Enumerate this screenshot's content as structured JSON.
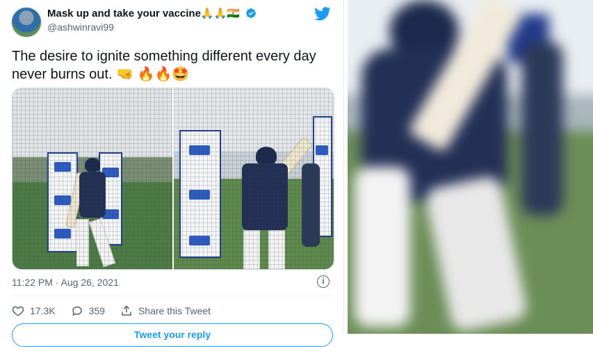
{
  "tweet": {
    "display_name": "Mask up and take your vaccine",
    "name_emojis": "🙏🙏🇮🇳",
    "handle": "@ashwinravi99",
    "text": "The desire to ignite something different every day never burns out. 🤜 🔥🔥🤩",
    "timestamp": "11:22 PM · Aug 26, 2021",
    "likes": "17.3K",
    "replies": "359",
    "share_label": "Share this Tweet",
    "reply_button_label": "Tweet your reply"
  },
  "colors": {
    "twitter_blue": "#1d9bf0",
    "verified_blue": "#1d9bf0",
    "text_primary": "#0f1419",
    "text_secondary": "#536471"
  },
  "icons": [
    "avatar",
    "verified-badge-icon",
    "twitter-bird-icon",
    "info-icon",
    "heart-icon",
    "reply-icon",
    "share-icon"
  ]
}
